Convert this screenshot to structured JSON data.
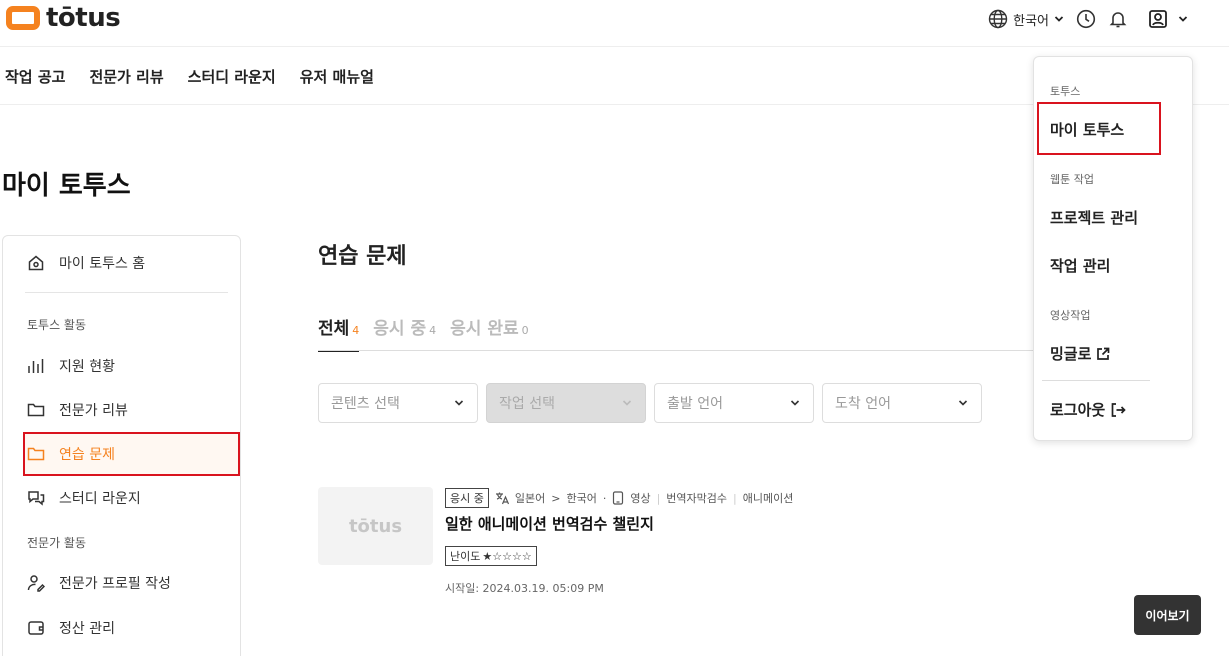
{
  "header": {
    "logo_text": "tōtus",
    "language": "한국어",
    "brand_color": "#f5821f"
  },
  "nav": {
    "items": [
      "작업 공고",
      "전문가 리뷰",
      "스터디 라운지",
      "유저 매뉴얼"
    ]
  },
  "page_title": "마이 토투스",
  "sidebar": {
    "home": "마이 토투스 홈",
    "group1": "토투스 활동",
    "items1": [
      "지원 현황",
      "전문가 리뷰",
      "연습 문제",
      "스터디 라운지"
    ],
    "group2": "전문가 활동",
    "items2": [
      "전문가 프로필 작성",
      "정산 관리"
    ],
    "active": "연습 문제"
  },
  "main": {
    "title": "연습 문제",
    "tabs": [
      {
        "label": "전체",
        "count": "4"
      },
      {
        "label": "응시 중",
        "count": "4"
      },
      {
        "label": "응시 완료",
        "count": "0"
      }
    ],
    "filters": [
      "콘텐츠 선택",
      "작업 선택",
      "출발 언어",
      "도착 언어"
    ]
  },
  "card": {
    "thumb_text": "tōtus",
    "status_badge": "응시 중",
    "source_lang": "일본어",
    "arrow": ">",
    "target_lang": "한국어",
    "dot": "·",
    "content_type": "영상",
    "task_type": "번역자막검수",
    "genre": "애니메이션",
    "title": "일한 애니메이션 번역검수 챌린지",
    "difficulty_label": "난이도",
    "difficulty_stars": "★☆☆☆☆",
    "difficulty_rating": 1,
    "start_date": "시작일: 2024.03.19. 05:09 PM",
    "continue_label": "이어보기"
  },
  "dropdown": {
    "group1": "토투스",
    "my_totus": "마이 토투스",
    "group2": "웹툰 작업",
    "project_mgmt": "프로젝트 관리",
    "task_mgmt": "작업 관리",
    "group3": "영상작업",
    "mingle": "밍글로",
    "logout": "로그아웃"
  }
}
